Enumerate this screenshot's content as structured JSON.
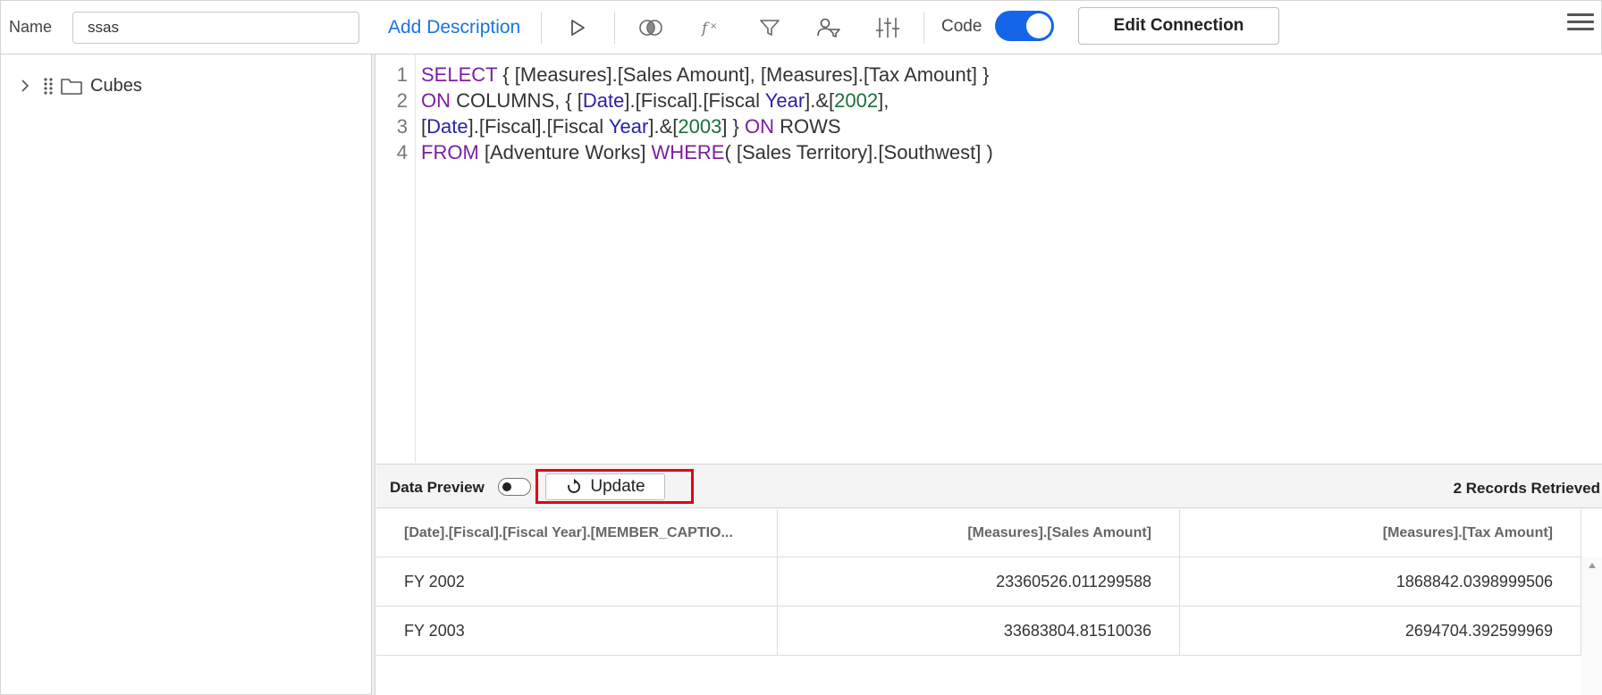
{
  "toolbar": {
    "name_label": "Name",
    "name_value": "ssas",
    "add_description": "Add Description",
    "code_label": "Code",
    "code_enabled": true,
    "edit_connection": "Edit Connection",
    "icons": [
      "play-icon",
      "join-icon",
      "formula-icon",
      "filter-icon",
      "user-filter-icon",
      "parameters-icon",
      "hamburger-menu-icon"
    ]
  },
  "tree": {
    "items": [
      {
        "label": "Cubes",
        "icon": "folder-icon",
        "expanded": false
      }
    ]
  },
  "editor": {
    "line_numbers": [
      "1",
      "2",
      "3",
      "4"
    ]
  },
  "preview": {
    "label": "Data Preview",
    "enabled": false,
    "update_label": "Update",
    "records": "2 Records Retrieved"
  },
  "grid": {
    "columns": [
      "[Date].[Fiscal].[Fiscal Year].[MEMBER_CAPTIO...",
      "[Measures].[Sales Amount]",
      "[Measures].[Tax Amount]"
    ],
    "rows": [
      [
        "FY 2002",
        "23360526.011299588",
        "1868842.0398999506"
      ],
      [
        "FY 2003",
        "33683804.81510036",
        "2694704.392599969"
      ]
    ]
  }
}
